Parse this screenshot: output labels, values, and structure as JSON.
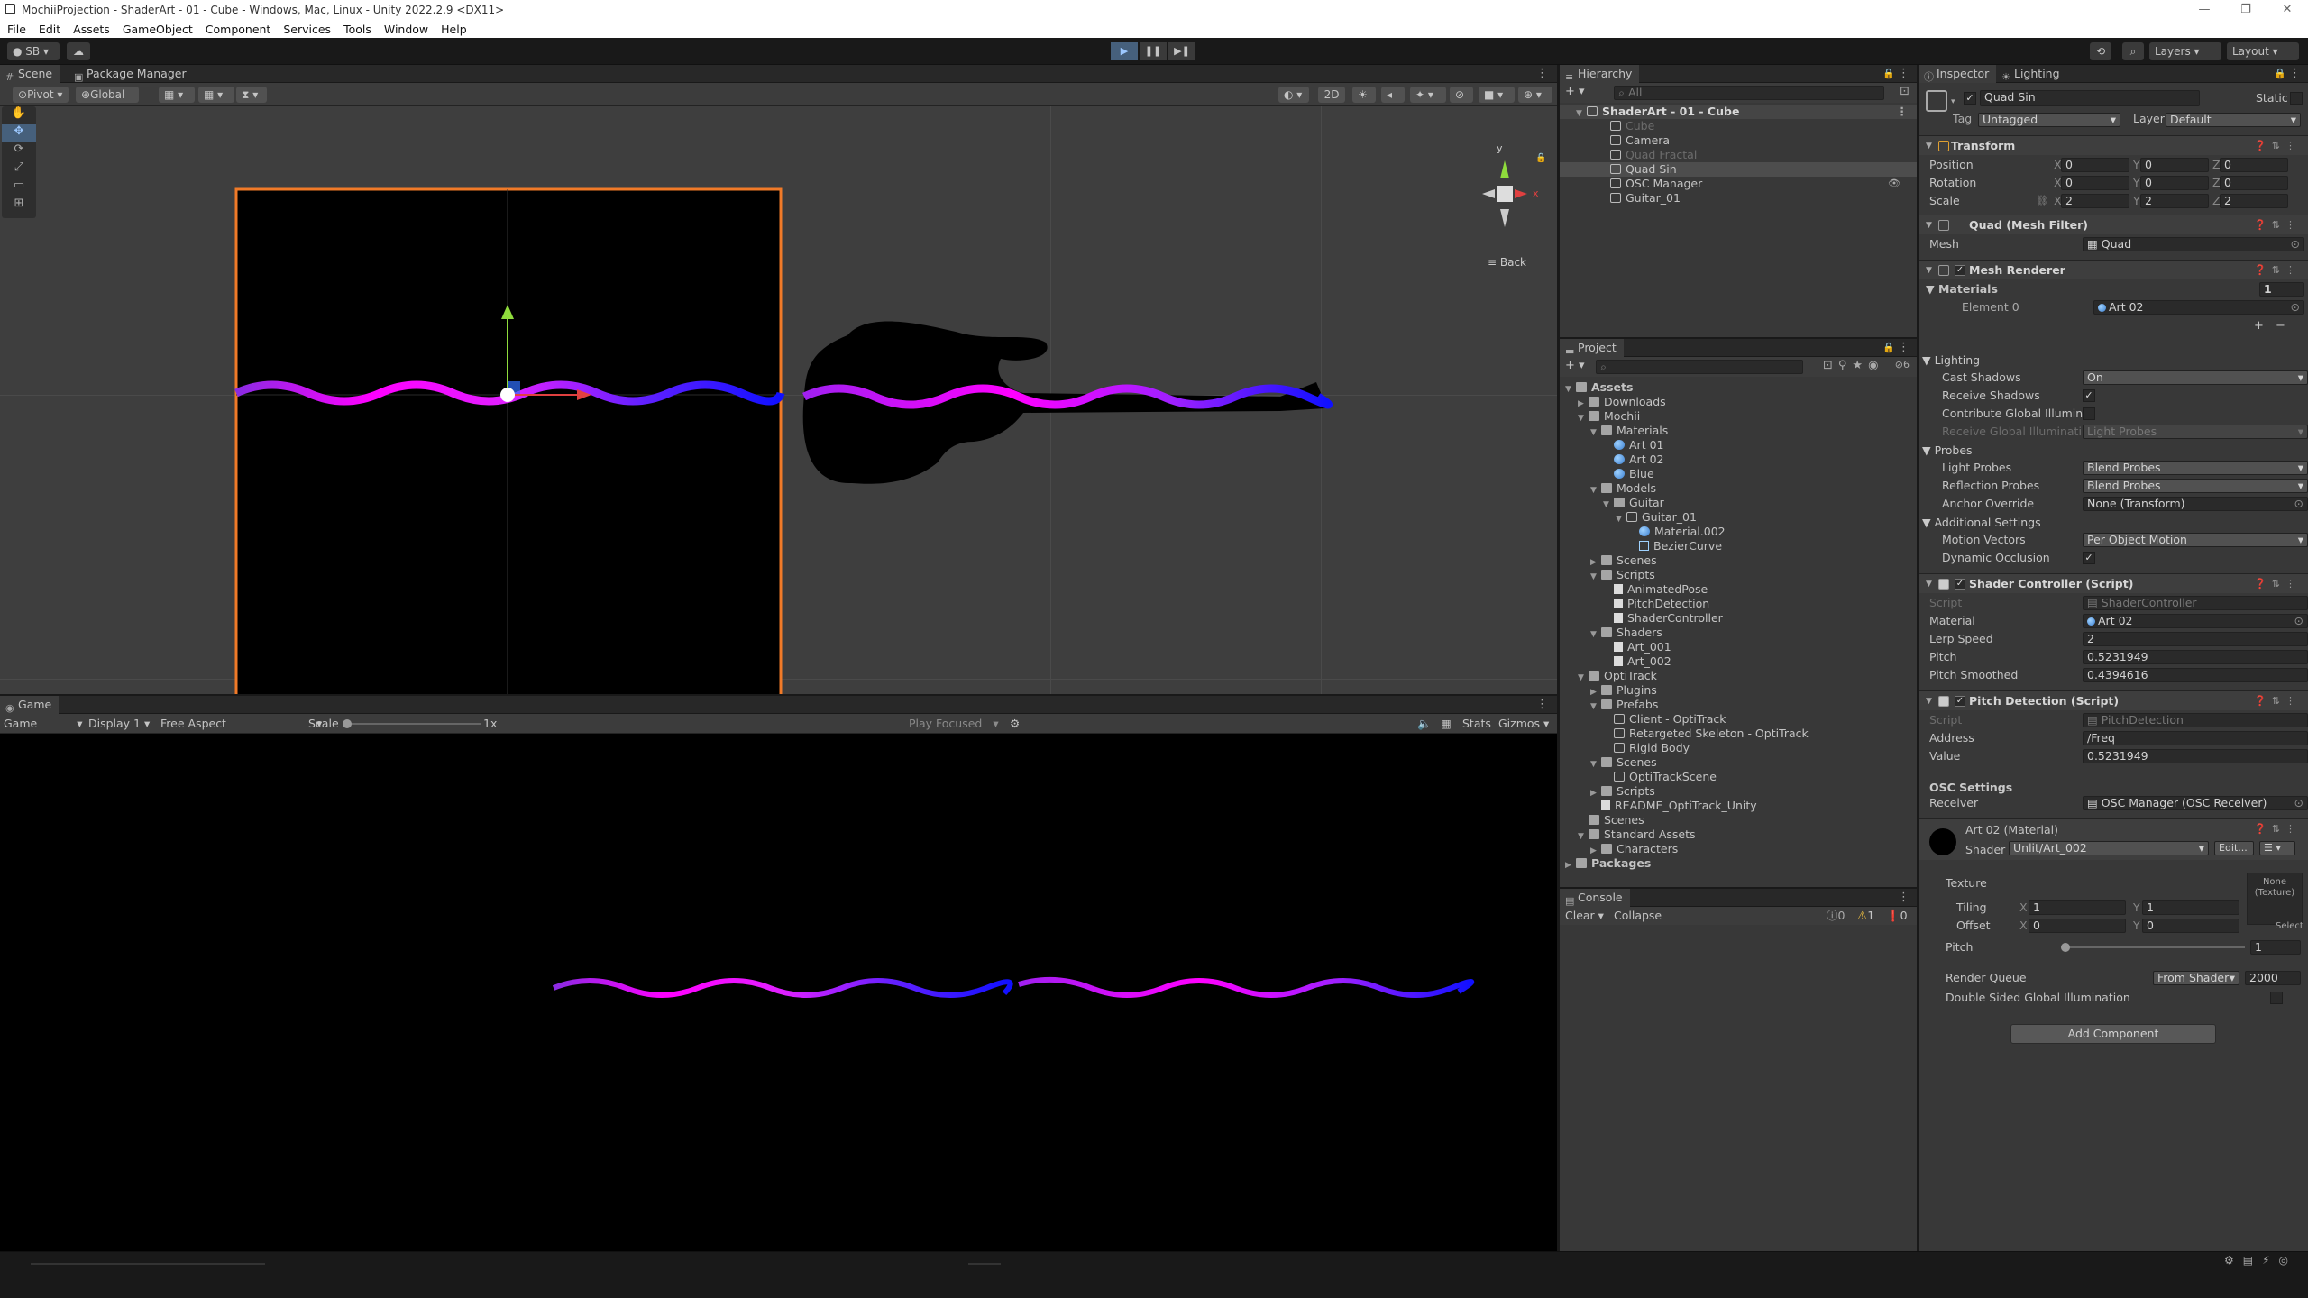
{
  "window": {
    "title": "MochiiProjection - ShaderArt - 01 - Cube - Windows, Mac, Linux - Unity 2022.2.9 <DX11>",
    "controls": [
      "—",
      "❐",
      "✕"
    ]
  },
  "menu": [
    "File",
    "Edit",
    "Assets",
    "GameObject",
    "Component",
    "Services",
    "Tools",
    "Window",
    "Help"
  ],
  "toolbar": {
    "account": "SB",
    "layers": "Layers",
    "layout": "Layout"
  },
  "scene": {
    "tabs": [
      "Scene",
      "Package Manager"
    ],
    "pivot": "Pivot",
    "global": "Global",
    "mode2d": "2D",
    "back_label": "Back",
    "gizmo_y": "y",
    "gizmo_x": "x"
  },
  "game": {
    "tab": "Game",
    "view": "Game",
    "display": "Display 1",
    "aspect": "Free Aspect",
    "scale_label": "Scale",
    "scale_value": "1x",
    "play_focused": "Play Focused",
    "stats": "Stats",
    "gizmos": "Gizmos"
  },
  "hierarchy": {
    "tab": "Hierarchy",
    "search": "All",
    "scene_name": "ShaderArt - 01 - Cube",
    "items": [
      {
        "label": "Cube",
        "faded": true
      },
      {
        "label": "Camera",
        "faded": false
      },
      {
        "label": "Quad Fractal",
        "faded": true
      },
      {
        "label": "Quad Sin",
        "faded": false,
        "selected": true
      },
      {
        "label": "OSC Manager",
        "faded": false
      },
      {
        "label": "Guitar_01",
        "faded": false
      }
    ]
  },
  "project": {
    "tab": "Project",
    "tree": [
      {
        "label": "Assets",
        "depth": 0,
        "icon": "folder",
        "open": true,
        "bold": true
      },
      {
        "label": "Downloads",
        "depth": 1,
        "icon": "folder",
        "open": false
      },
      {
        "label": "Mochii",
        "depth": 1,
        "icon": "folder",
        "open": true
      },
      {
        "label": "Materials",
        "depth": 2,
        "icon": "folder",
        "open": true
      },
      {
        "label": "Art 01",
        "depth": 3,
        "icon": "mat"
      },
      {
        "label": "Art 02",
        "depth": 3,
        "icon": "mat"
      },
      {
        "label": "Blue",
        "depth": 3,
        "icon": "mat"
      },
      {
        "label": "Models",
        "depth": 2,
        "icon": "folder",
        "open": true
      },
      {
        "label": "Guitar",
        "depth": 3,
        "icon": "folder",
        "open": true
      },
      {
        "label": "Guitar_01",
        "depth": 4,
        "icon": "cube",
        "open": true
      },
      {
        "label": "Material.002",
        "depth": 5,
        "icon": "mat"
      },
      {
        "label": "BezierCurve",
        "depth": 5,
        "icon": "mesh"
      },
      {
        "label": "Scenes",
        "depth": 2,
        "icon": "folder",
        "open": false
      },
      {
        "label": "Scripts",
        "depth": 2,
        "icon": "folder",
        "open": true
      },
      {
        "label": "AnimatedPose",
        "depth": 3,
        "icon": "script"
      },
      {
        "label": "PitchDetection",
        "depth": 3,
        "icon": "script"
      },
      {
        "label": "ShaderController",
        "depth": 3,
        "icon": "script"
      },
      {
        "label": "Shaders",
        "depth": 2,
        "icon": "folder",
        "open": true
      },
      {
        "label": "Art_001",
        "depth": 3,
        "icon": "script"
      },
      {
        "label": "Art_002",
        "depth": 3,
        "icon": "script"
      },
      {
        "label": "OptiTrack",
        "depth": 1,
        "icon": "folder",
        "open": true
      },
      {
        "label": "Plugins",
        "depth": 2,
        "icon": "folder",
        "open": false
      },
      {
        "label": "Prefabs",
        "depth": 2,
        "icon": "folder",
        "open": true
      },
      {
        "label": "Client - OptiTrack",
        "depth": 3,
        "icon": "cube"
      },
      {
        "label": "Retargeted Skeleton - OptiTrack",
        "depth": 3,
        "icon": "cube"
      },
      {
        "label": "Rigid Body",
        "depth": 3,
        "icon": "cube"
      },
      {
        "label": "Scenes",
        "depth": 2,
        "icon": "folder",
        "open": true
      },
      {
        "label": "OptiTrackScene",
        "depth": 3,
        "icon": "cube"
      },
      {
        "label": "Scripts",
        "depth": 2,
        "icon": "folder",
        "open": false
      },
      {
        "label": "README_OptiTrack_Unity",
        "depth": 2,
        "icon": "script"
      },
      {
        "label": "Scenes",
        "depth": 1,
        "icon": "folder"
      },
      {
        "label": "Standard Assets",
        "depth": 1,
        "icon": "folder",
        "open": true
      },
      {
        "label": "Characters",
        "depth": 2,
        "icon": "folder",
        "open": false
      },
      {
        "label": "Packages",
        "depth": 0,
        "icon": "folder",
        "open": false,
        "bold": true
      }
    ]
  },
  "console": {
    "tab": "Console",
    "clear": "Clear",
    "collapse": "Collapse",
    "counts": [
      "0",
      "1",
      "0"
    ]
  },
  "inspector": {
    "tabs": [
      "Inspector",
      "Lighting"
    ],
    "object_name": "Quad Sin",
    "static_label": "Static",
    "tag_label": "Tag",
    "tag": "Untagged",
    "layer_label": "Layer",
    "layer": "Default",
    "transform": {
      "title": "Transform",
      "position_label": "Position",
      "rotation_label": "Rotation",
      "scale_label": "Scale",
      "position": [
        "0",
        "0",
        "0"
      ],
      "rotation": [
        "0",
        "0",
        "0"
      ],
      "scale": [
        "2",
        "2",
        "2"
      ],
      "axes": [
        "X",
        "Y",
        "Z"
      ]
    },
    "mesh_filter": {
      "title": "Quad (Mesh Filter)",
      "mesh_label": "Mesh",
      "mesh": "Quad"
    },
    "mesh_renderer": {
      "title": "Mesh Renderer",
      "materials_label": "Materials",
      "materials_count": "1",
      "element_label": "Element 0",
      "element_value": "Art 02",
      "lighting_label": "Lighting",
      "cast_shadows_label": "Cast Shadows",
      "cast_shadows": "On",
      "receive_shadows_label": "Receive Shadows",
      "contribute_gi_label": "Contribute Global Illumina",
      "receive_gi_label": "Receive Global Illuminati",
      "receive_gi": "Light Probes",
      "probes_label": "Probes",
      "light_probes_label": "Light Probes",
      "light_probes": "Blend Probes",
      "reflection_probes_label": "Reflection Probes",
      "reflection_probes": "Blend Probes",
      "anchor_label": "Anchor Override",
      "anchor": "None (Transform)",
      "additional_label": "Additional Settings",
      "motion_vectors_label": "Motion Vectors",
      "motion_vectors": "Per Object Motion",
      "dynamic_occlusion_label": "Dynamic Occlusion"
    },
    "shader_controller": {
      "title": "Shader Controller (Script)",
      "script_label": "Script",
      "script": "ShaderController",
      "material_label": "Material",
      "material": "Art 02",
      "lerp_label": "Lerp Speed",
      "lerp": "2",
      "pitch_label": "Pitch",
      "pitch": "0.5231949",
      "pitch_smoothed_label": "Pitch Smoothed",
      "pitch_smoothed": "0.4394616"
    },
    "pitch_detection": {
      "title": "Pitch Detection (Script)",
      "script_label": "Script",
      "script": "PitchDetection",
      "address_label": "Address",
      "address": "/Freq",
      "value_label": "Value",
      "value": "0.5231949",
      "osc_label": "OSC Settings",
      "receiver_label": "Receiver",
      "receiver": "OSC Manager (OSC Receiver)"
    },
    "material": {
      "title": "Art 02 (Material)",
      "shader_label": "Shader",
      "shader": "Unlit/Art_002",
      "edit_label": "Edit...",
      "texture_label": "Texture",
      "texture_none": "None",
      "texture_kind": "(Texture)",
      "tiling_label": "Tiling",
      "offset_label": "Offset",
      "tiling": [
        "1",
        "1"
      ],
      "offset": [
        "0",
        "0"
      ],
      "select_label": "Select",
      "pitch_label": "Pitch",
      "pitch_value": "1",
      "render_queue_label": "Render Queue",
      "render_queue_mode": "From Shader",
      "render_queue_value": "2000",
      "double_sided_label": "Double Sided Global Illumination"
    },
    "add_component": "Add Component"
  },
  "colors": {
    "wave_magenta": "#ff00ff",
    "wave_purple": "#8a2be2",
    "wave_blue": "#1010ff",
    "selection_orange": "#f07a28",
    "accent": "#2c5d87"
  }
}
